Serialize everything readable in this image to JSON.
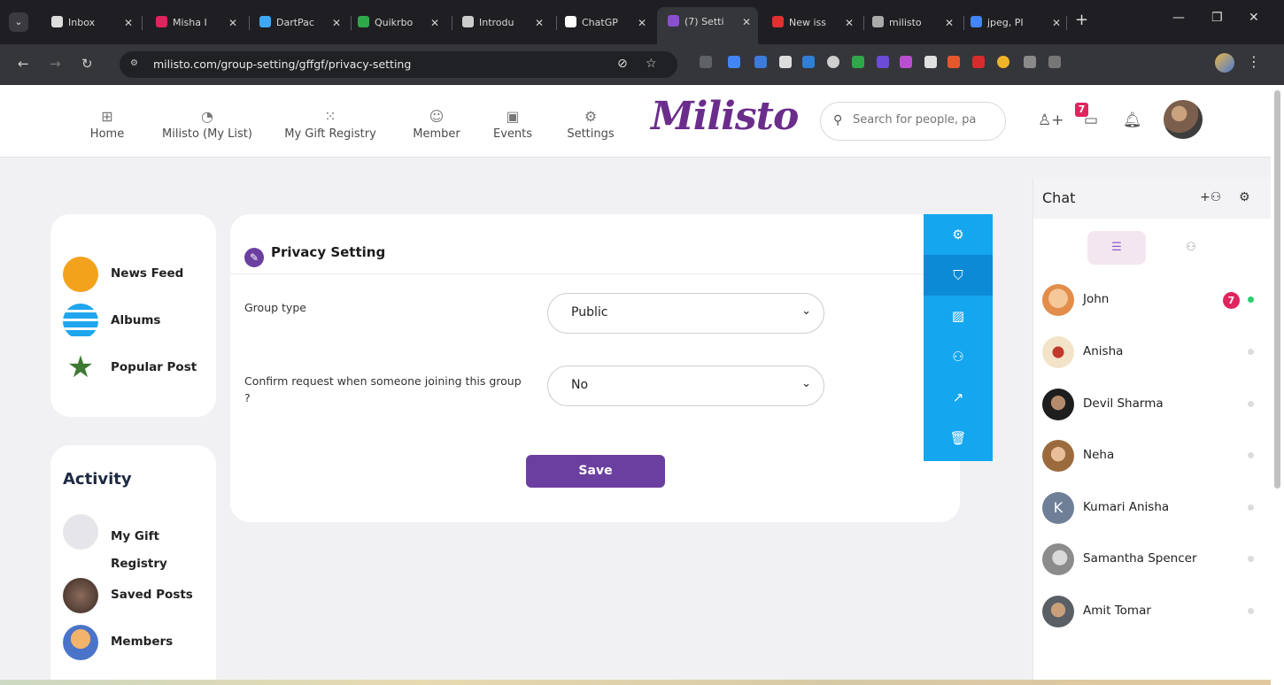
{
  "browser": {
    "tabs": [
      {
        "label": "Inbox",
        "color": "#dddddd"
      },
      {
        "label": "Misha I",
        "color": "#e0245e"
      },
      {
        "label": "DartPac",
        "color": "#3fa9f5"
      },
      {
        "label": "Quikrbo",
        "color": "#2eaa4a"
      },
      {
        "label": "Introdu",
        "color": "#cccccc"
      },
      {
        "label": "ChatGP",
        "color": "#ffffff"
      },
      {
        "label": "(7) Setti",
        "color": "#8a4fd0"
      },
      {
        "label": "New iss",
        "color": "#e03030"
      },
      {
        "label": "milisto",
        "color": "#aaaaaa"
      },
      {
        "label": "jpeg, PI",
        "color": "#4285f4"
      }
    ],
    "close_glyph": "✕",
    "new_tab_glyph": "+",
    "url": "milisto.com/group-setting/gffgf/privacy-setting"
  },
  "nav": {
    "items": [
      {
        "label": "Home",
        "icon": "grid-icon"
      },
      {
        "label": "Milisto (My List)",
        "icon": "pie-icon"
      },
      {
        "label": "My Gift Registry",
        "icon": "dots-grid-icon"
      },
      {
        "label": "Member",
        "icon": "chat-bubble-icon"
      },
      {
        "label": "Events",
        "icon": "calendar-icon"
      },
      {
        "label": "Settings",
        "icon": "gear-icon"
      }
    ],
    "brand": "Milisto",
    "search_placeholder": "Search for people, pa",
    "notification_count": "7"
  },
  "left_menu": {
    "items": [
      {
        "label": "News Feed",
        "color": "#f3a21c"
      },
      {
        "label": "Albums",
        "color": "#1fa6ee"
      },
      {
        "label": "Popular Post",
        "color": "#3f7a33"
      }
    ]
  },
  "activity": {
    "title": "Activity",
    "items": [
      {
        "label": "My Gift Registry"
      },
      {
        "label": "Saved Posts"
      },
      {
        "label": "Members"
      }
    ]
  },
  "privacy": {
    "title": "Privacy Setting",
    "fields": [
      {
        "label": "Group type",
        "value": "Public"
      },
      {
        "label": "Confirm request when someone joining this group ?",
        "value": "No"
      }
    ],
    "save_label": "Save"
  },
  "side_menu": {
    "items": [
      {
        "icon": "gear-icon",
        "active": false
      },
      {
        "icon": "shield-icon",
        "active": true
      },
      {
        "icon": "image-icon",
        "active": false
      },
      {
        "icon": "users-icon",
        "active": false
      },
      {
        "icon": "trending-up-icon",
        "active": false
      },
      {
        "icon": "trash-icon",
        "active": false
      }
    ]
  },
  "chat": {
    "title": "Chat",
    "contacts": [
      {
        "name": "John",
        "unread": "7",
        "online": true
      },
      {
        "name": "Anisha",
        "online": false
      },
      {
        "name": "Devil Sharma",
        "online": false
      },
      {
        "name": "Neha",
        "online": false
      },
      {
        "name": "Kumari Anisha",
        "initial": "K",
        "online": false
      },
      {
        "name": "Samantha Spencer",
        "online": false
      },
      {
        "name": "Amit Tomar",
        "online": false
      }
    ]
  }
}
